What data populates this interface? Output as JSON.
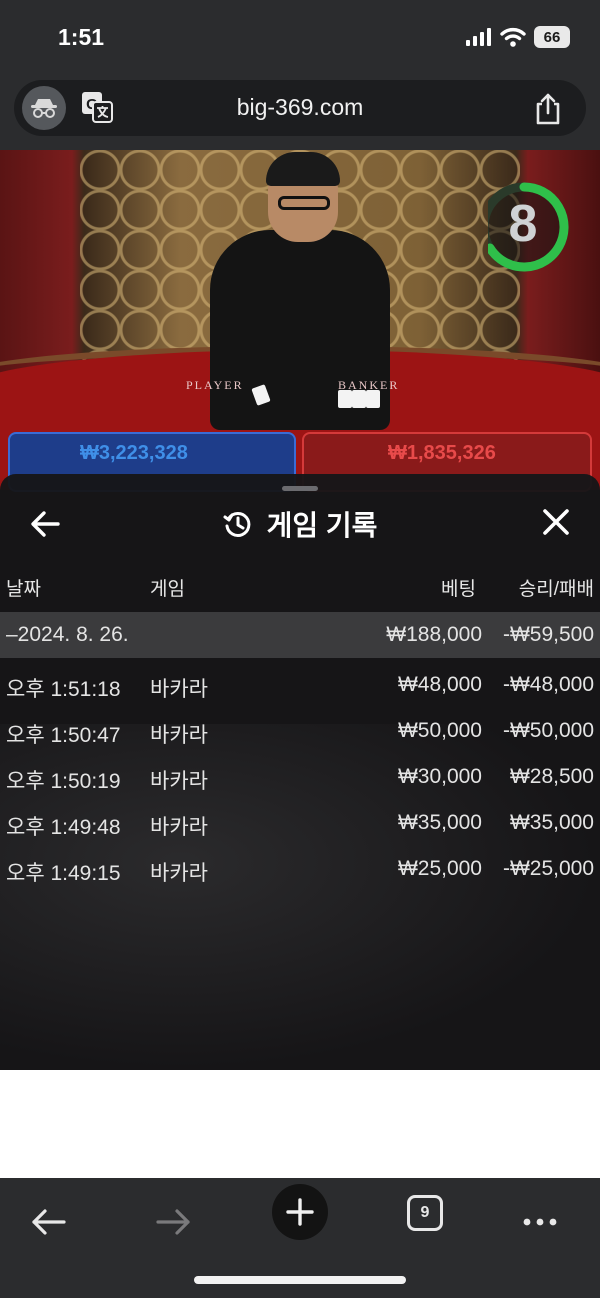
{
  "status": {
    "time": "1:51",
    "battery": "66",
    "icons": [
      "signal-icon",
      "wifi-icon",
      "battery-icon"
    ]
  },
  "browser": {
    "url": "big-369.com",
    "icons": [
      "incognito-icon",
      "translate-icon",
      "share-icon"
    ]
  },
  "game": {
    "timer": "8",
    "player_label": "PLAYER",
    "banker_label": "BANKER",
    "player_bet": "₩3,223,328",
    "banker_bet": "₩1,835,326"
  },
  "history": {
    "title": "게임 기록",
    "columns": {
      "date": "날짜",
      "game": "게임",
      "bet": "베팅",
      "result": "승리/패배"
    },
    "summary": {
      "date": "–2024. 8. 26.",
      "bet": "₩188,000",
      "result": "-₩59,500"
    },
    "rows": [
      {
        "time": "오후 1:51:18",
        "game": "바카라",
        "bet": "₩48,000",
        "result": "-₩48,000"
      },
      {
        "time": "오후 1:50:47",
        "game": "바카라",
        "bet": "₩50,000",
        "result": "-₩50,000"
      },
      {
        "time": "오후 1:50:19",
        "game": "바카라",
        "bet": "₩30,000",
        "result": "₩28,500"
      },
      {
        "time": "오후 1:49:48",
        "game": "바카라",
        "bet": "₩35,000",
        "result": "₩35,000"
      },
      {
        "time": "오후 1:49:15",
        "game": "바카라",
        "bet": "₩25,000",
        "result": "-₩25,000"
      }
    ]
  },
  "bottom_bar": {
    "tab_count": "9"
  }
}
